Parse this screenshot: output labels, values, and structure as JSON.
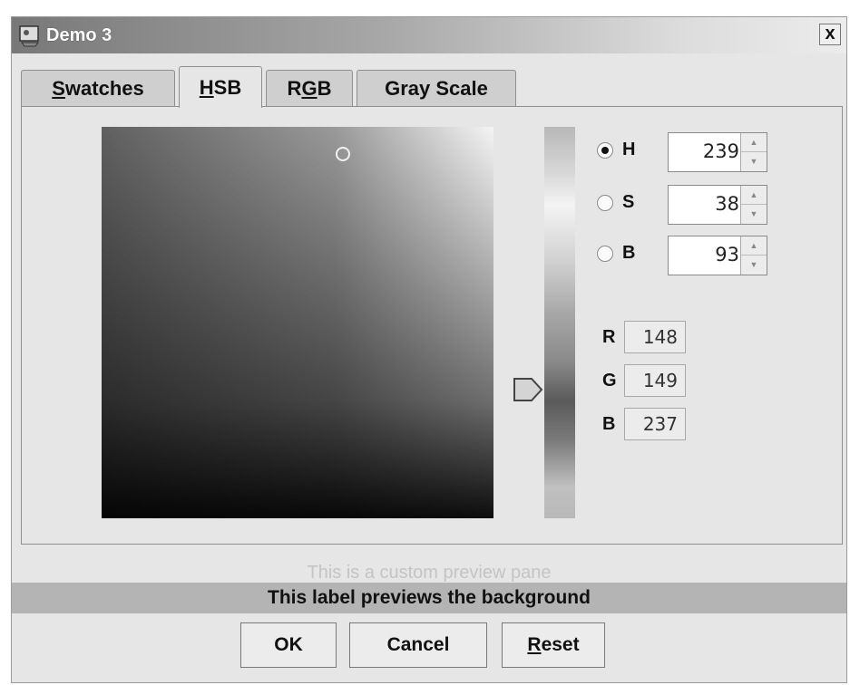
{
  "window": {
    "title": "Demo 3",
    "close_label": "x"
  },
  "tabs": [
    {
      "label": "Swatches",
      "mnemonic": "S",
      "rest": "watches"
    },
    {
      "label": "HSB",
      "mnemonic": "H",
      "rest": "SB"
    },
    {
      "label": "RGB",
      "pre": "R",
      "mnemonic": "G",
      "rest": "B"
    },
    {
      "label": "Gray Scale"
    }
  ],
  "active_tab": "HSB",
  "hsb": {
    "h": {
      "label": "H",
      "value": "239",
      "selected": true
    },
    "s": {
      "label": "S",
      "value": "38",
      "selected": false
    },
    "b": {
      "label": "B",
      "value": "93",
      "selected": false
    }
  },
  "rgb": {
    "r": {
      "label": "R",
      "value": "148"
    },
    "g": {
      "label": "G",
      "value": "149"
    },
    "b": {
      "label": "B",
      "value": "237"
    }
  },
  "preview": {
    "caption": "This is a custom preview pane",
    "label": "This label previews the background"
  },
  "buttons": {
    "ok": "OK",
    "cancel": "Cancel",
    "reset_mnemonic": "R",
    "reset_rest": "eset"
  },
  "icons": {
    "app": "applet-icon",
    "close": "close-icon",
    "slider": "slider-arrow-icon"
  }
}
